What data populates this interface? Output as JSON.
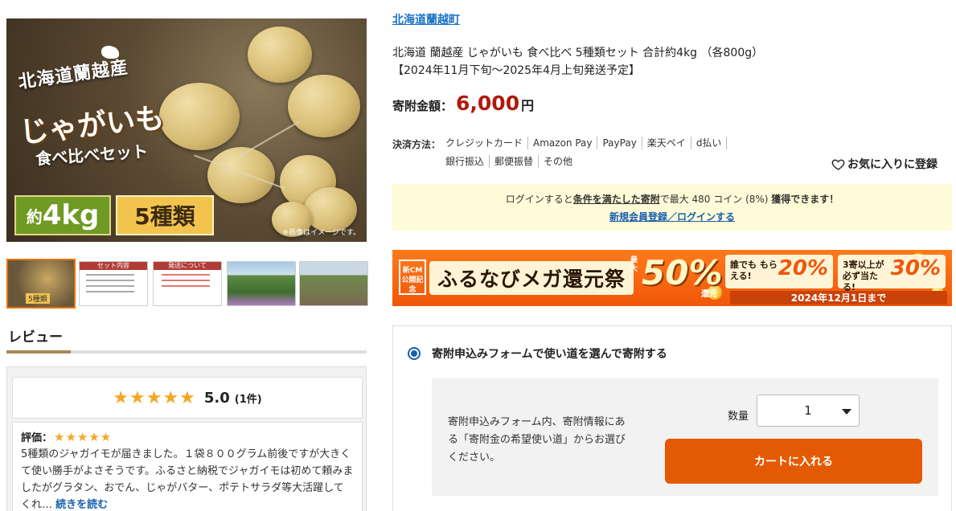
{
  "main_image": {
    "origin": "北海道蘭越産",
    "product": "じゃがいも",
    "subtitle": "食べ比べセット",
    "weight_prefix": "約",
    "weight": "4kg",
    "kinds": "5種類",
    "note": "※画像はイメージです。"
  },
  "thumbnails": [
    {
      "label": "5種類"
    },
    {
      "header": "セット内容"
    },
    {
      "header": "発送について"
    },
    {},
    {}
  ],
  "review": {
    "title": "レビュー",
    "stars": "★★★★★",
    "score": "5.0",
    "count": "(1件)",
    "card": {
      "rating_label": "評価：",
      "rating_stars": "★★★★★",
      "text": "5種類のジャガイモが届きました。１袋８００グラム前後ですが大きくて使い勝手がよさそうです。ふるさと納税でジャガイモは初めて頼みましたがグラタン、おでん、じゃがバター、ポテトサラダ等大活躍してくれ…",
      "read_more": "続きを読む"
    }
  },
  "product": {
    "town": "北海道蘭越町",
    "title_line1": "北海道 蘭越産 じゃがいも 食べ比べ 5種類セット 合計約4kg （各800g）",
    "title_line2": "【2024年11月下旬～2025年4月上旬発送予定】",
    "price_label": "寄附金額：",
    "price": "6,000",
    "price_unit": "円"
  },
  "payment": {
    "label": "決済方法：",
    "row1": [
      "クレジットカード",
      "Amazon Pay",
      "PayPay",
      "楽天ペイ",
      "d払い"
    ],
    "row2": [
      "銀行振込",
      "郵便振替",
      "その他"
    ]
  },
  "favorite": {
    "label": "お気に入りに登録"
  },
  "login_notice": {
    "text_a": "ログインすると",
    "text_b": "条件を満たした寄附",
    "text_c": "で最大 480 コイン (8%)",
    "text_d": "獲得できます！",
    "link": "新規会員登録／ログインする"
  },
  "banner": {
    "cm": "新CM 公開記念",
    "title": "ふるなびメガ還元祭",
    "max": "最大",
    "percent": "50%",
    "kangen": "還元",
    "box1_text": "誰でも もらえる!",
    "box1_pct": "20%",
    "box2_text": "3寄以上が 必ず当たる!",
    "box2_pct": "30%",
    "date": "2024年12月1日まで"
  },
  "donation_form": {
    "option_label": "寄附申込みフォームで使い道を選んで寄附する",
    "description": "寄附申込みフォーム内、寄附情報にある「寄附金の希望使い道」からお選びください。",
    "quantity_label": "数量",
    "quantity_value": "1",
    "cart_button": "カートに入れる"
  }
}
